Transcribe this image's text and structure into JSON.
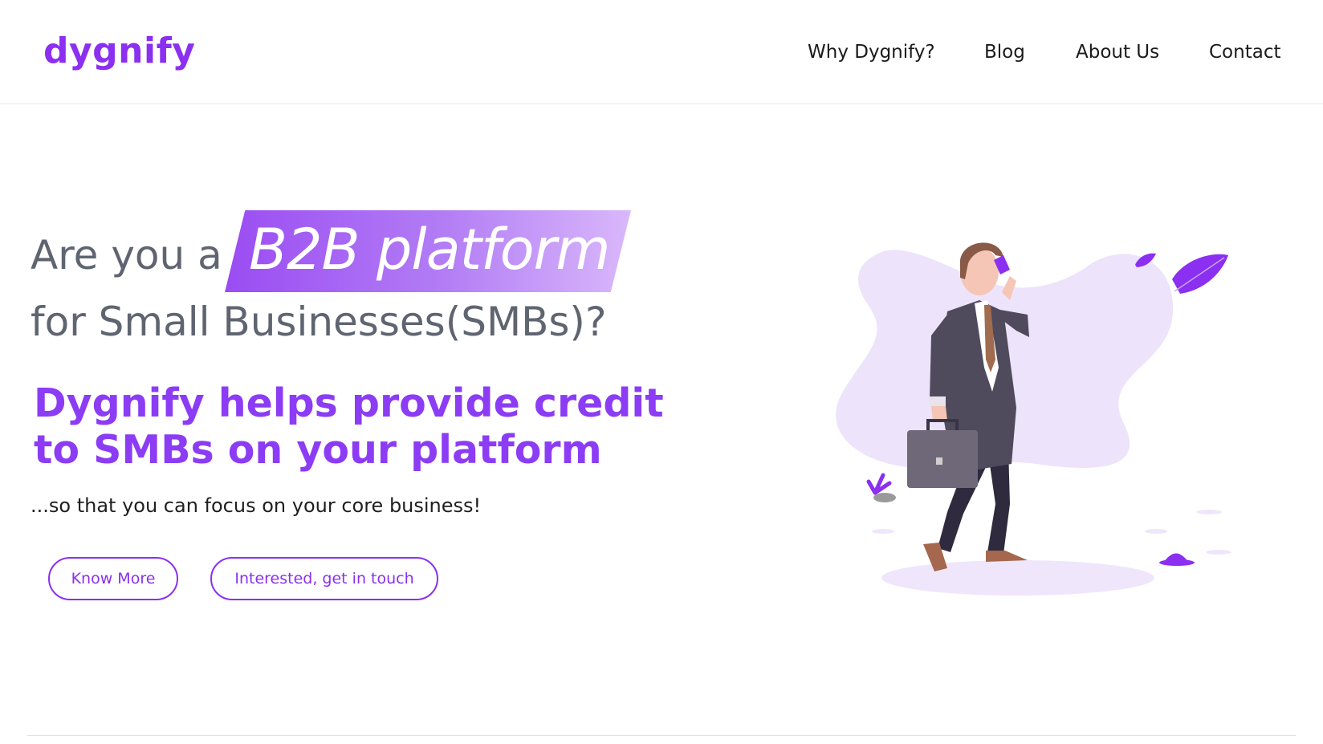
{
  "header": {
    "logo_text": "dygnify",
    "nav": [
      "Why Dygnify?",
      "Blog",
      "About Us",
      "Contact"
    ]
  },
  "hero": {
    "line1_prefix": "Are you a",
    "highlight": "B2B platform",
    "line2": "for Small Businesses(SMBs)?",
    "subhead": "Dygnify helps provide credit to SMBs on your platform",
    "tagline": "...so that you can focus on your core business!",
    "buttons": {
      "know_more": "Know More",
      "get_in_touch": "Interested, get in touch"
    }
  },
  "colors": {
    "brand": "#8b2ff0",
    "heading_gray": "#5f6570",
    "blob": "#ede3fb"
  },
  "illustration": {
    "icon": "businessman-on-phone-illustration"
  }
}
